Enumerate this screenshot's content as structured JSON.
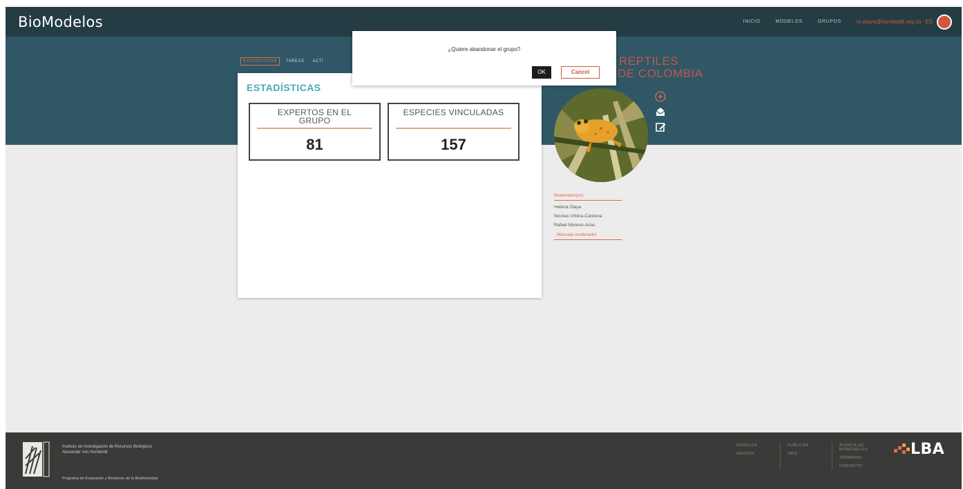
{
  "header": {
    "brand": "BioModelos",
    "nav": [
      "INICIO",
      "MODELOS",
      "GRUPOS"
    ],
    "user_email": "m.olaya@humboldt.org.co",
    "lang": "ES"
  },
  "tabs": [
    "ESTADÍSTICAS",
    "TAREAS",
    "ACTI"
  ],
  "group": {
    "title_line1": "REPTILES",
    "title_line2": "DE COLOMBIA"
  },
  "panel": {
    "title": "ESTADÍSTICAS",
    "stats": [
      {
        "label": "EXPERTOS EN EL GRUPO",
        "value": "81"
      },
      {
        "label": "ESPECIES VINCULADAS",
        "value": "157"
      }
    ]
  },
  "moderators": {
    "heading": "Moderador(es)",
    "names": [
      "Helena Olaya",
      "Nicolas Urbina-Cardona",
      "Rafael Moreno-Arias"
    ],
    "message_link": "Mensaje moderador"
  },
  "dialog": {
    "message": "¿Quiere abandonar el grupo?",
    "ok": "OK",
    "cancel": "Cancel"
  },
  "footer": {
    "institute": "Instituto de Investigación de Recursos Biológicos",
    "institute_sub": "Alexander von Humboldt",
    "program": "Programa de Evaluación y Monitoreo de la Biodiversidad",
    "col1": [
      "MODELOS",
      "GRUPOS"
    ],
    "col2": [
      "PUBLICAR",
      "INFO"
    ],
    "col3": [
      "ACERCA DE BIOMODELOS",
      "TÉRMINOS",
      "CONTACTO"
    ],
    "partner": "LBA"
  },
  "colors": {
    "accent": "#e36a4c",
    "nav": "#243c44",
    "band": "#2f5766",
    "title_blue": "#4aa7bd"
  }
}
